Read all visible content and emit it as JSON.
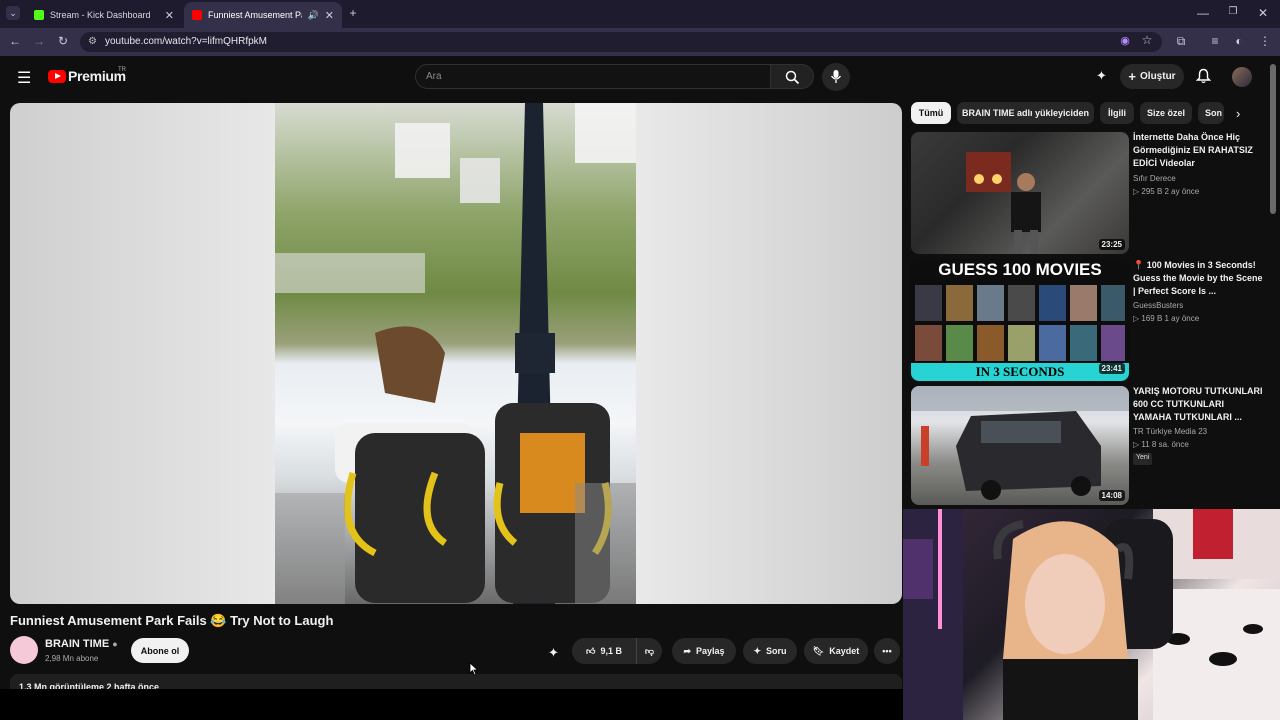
{
  "browser": {
    "tabs": [
      {
        "title": "Stream - Kick Dashboard",
        "active": false,
        "favicon_color": "#53fc18"
      },
      {
        "title": "Funniest Amusement Park I",
        "active": true,
        "favicon_color": "#ff0000"
      }
    ],
    "url": "youtube.com/watch?v=lifmQHRfpkM"
  },
  "youtube": {
    "logo_text": "Premium",
    "logo_region": "TR",
    "search_placeholder": "Ara",
    "create_label": "Oluştur",
    "accent": "#ff0000"
  },
  "video": {
    "title": "Funniest Amusement Park Fails 😂 Try Not to Laugh",
    "channel": "BRAIN TIME",
    "subscribers": "2,98 Mn abone",
    "subscribe_label": "Abone ol",
    "likes": "9,1 B",
    "share_label": "Paylaş",
    "ask_label": "Soru",
    "save_label": "Kaydet",
    "views_date": "1,3 Mn görüntüleme  2 hafta önce"
  },
  "chips": [
    "Tümü",
    "BRAIN TIME adlı yükleyiciden",
    "İlgili",
    "Size özel",
    "Son"
  ],
  "recommendations": [
    {
      "title": "İnternette Daha Önce Hiç Görmediğiniz EN RAHATSIZ EDİCİ Videolar",
      "channel": "Sıfır Derece",
      "meta": "▷ 295 B  2 ay önce",
      "duration": "23:25"
    },
    {
      "title": "📍 100 Movies in 3 Seconds! Guess the Movie by the Scene | Perfect Score Is ...",
      "channel": "GuessBusters",
      "meta": "▷ 169 B  1 ay önce",
      "duration": "23:41",
      "thumb_top": "GUESS 100 MOVIES",
      "thumb_bottom": "IN 3 SECONDS"
    },
    {
      "title": "YARIŞ MOTORU TUTKUNLARI 600 CC TUTKUNLARI YAMAHA TUTKUNLARI ...",
      "channel": "TR Türkiye Media 23",
      "meta": "▷ 11  8 sa. önce",
      "duration": "14:08",
      "badge": "Yeni"
    }
  ]
}
